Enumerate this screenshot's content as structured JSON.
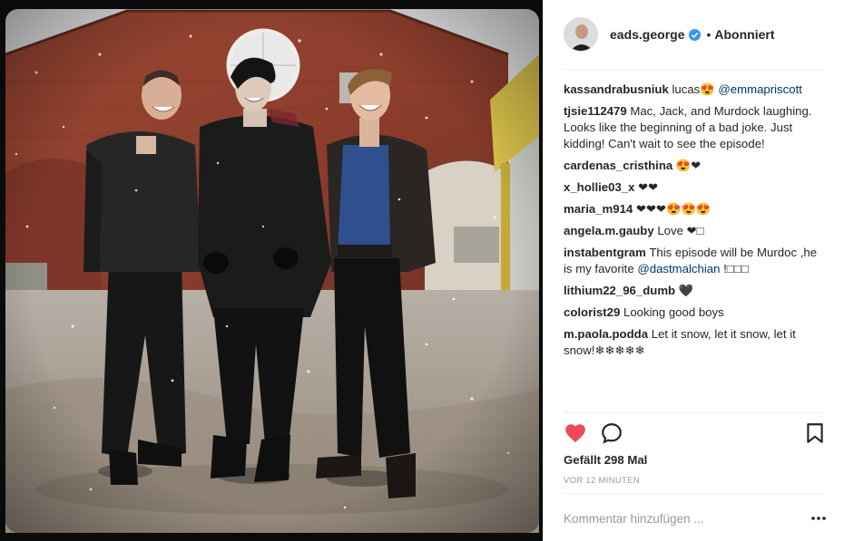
{
  "post": {
    "username": "eads.george",
    "follow_status": "Abonniert",
    "separator": "•"
  },
  "comments": [
    {
      "user": "kassandrabusniuk",
      "text": "lucas😍",
      "mention": "@emmapriscott",
      "after": ""
    },
    {
      "user": "tjsie112479",
      "text": "Mac, Jack, and Murdock laughing. Looks like the beginning of a bad joke. Just kidding! Can't wait to see the episode!",
      "mention": "",
      "after": ""
    },
    {
      "user": "cardenas_cristhina",
      "text": "😍❤",
      "mention": "",
      "after": ""
    },
    {
      "user": "x_hollie03_x",
      "text": "❤❤",
      "mention": "",
      "after": ""
    },
    {
      "user": "maria_m914",
      "text": "❤❤❤😍😍😍",
      "mention": "",
      "after": ""
    },
    {
      "user": "angela.m.gauby",
      "text": "Love ❤□",
      "mention": "",
      "after": ""
    },
    {
      "user": "instabentgram",
      "text": "This episode will be Murdoc ,he is my favorite",
      "mention": "@dastmalchian",
      "after": "!□□□"
    },
    {
      "user": "lithium22_96_dumb",
      "text": "🖤",
      "mention": "",
      "after": ""
    },
    {
      "user": "colorist29",
      "text": "Looking good boys",
      "mention": "",
      "after": ""
    },
    {
      "user": "m.paola.podda",
      "text": "Let it snow, let it snow, let it snow!❄❄❄❄❄",
      "mention": "",
      "after": ""
    }
  ],
  "likes": "Gefällt 298 Mal",
  "timestamp": "VOR 12 MINUTEN",
  "comment_input": {
    "placeholder": "Kommentar hinzufügen ..."
  },
  "icons": {
    "like": "heart-filled-icon",
    "comment": "comment-bubble-icon",
    "save": "bookmark-icon",
    "more": "more-dots-icon",
    "verified": "verified-badge-icon"
  },
  "colors": {
    "like_red": "#ed4956",
    "verified_blue": "#3897f0",
    "mention_blue": "#003569",
    "muted_gray": "#999999"
  }
}
